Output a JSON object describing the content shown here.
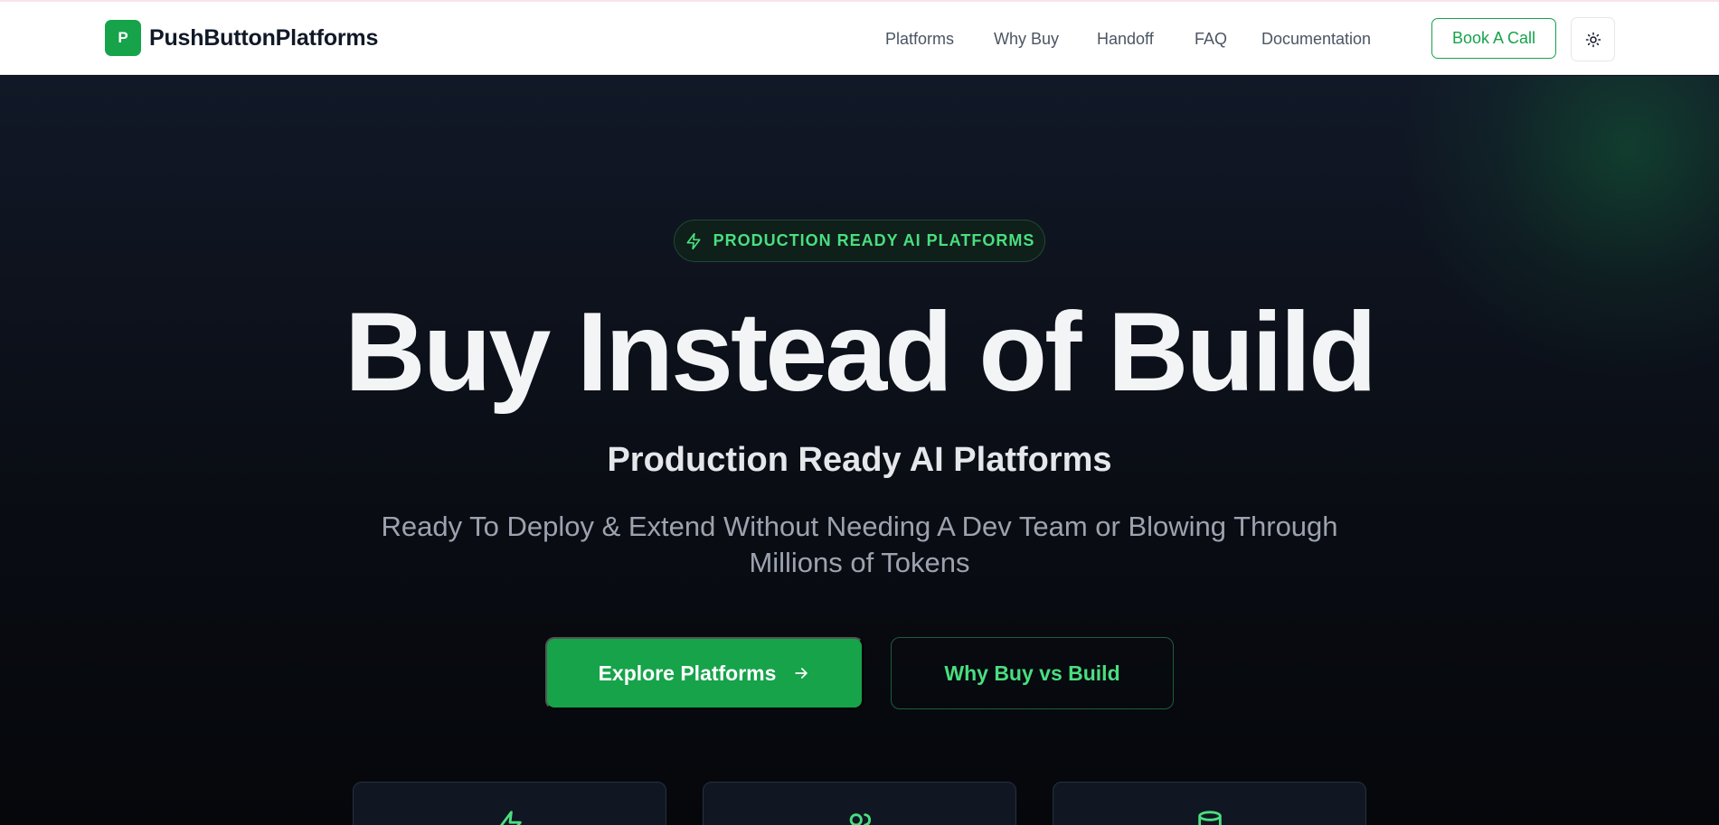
{
  "brand": {
    "logo_letter": "P",
    "name": "PushButtonPlatforms",
    "accent": "#16a34a"
  },
  "nav": {
    "links": [
      "Platforms",
      "Why Buy",
      "Handoff",
      "FAQ",
      "Documentation"
    ],
    "book_call": "Book A Call",
    "theme_icon": "sun-icon"
  },
  "hero": {
    "badge": "PRODUCTION READY AI PLATFORMS",
    "badge_icon": "lightning-icon",
    "title": "Buy Instead of Build",
    "subtitle": "Production Ready AI Platforms",
    "description": "Ready To Deploy & Extend Without Needing A Dev Team or Blowing Through Millions of Tokens",
    "primary_cta": "Explore Platforms",
    "secondary_cta": "Why Buy vs Build"
  },
  "feature_cards": [
    {
      "icon": "lightning-icon"
    },
    {
      "icon": "users-icon"
    },
    {
      "icon": "database-icon"
    }
  ],
  "colors": {
    "background": "#0b0f17",
    "accent_light": "#4ade80"
  }
}
